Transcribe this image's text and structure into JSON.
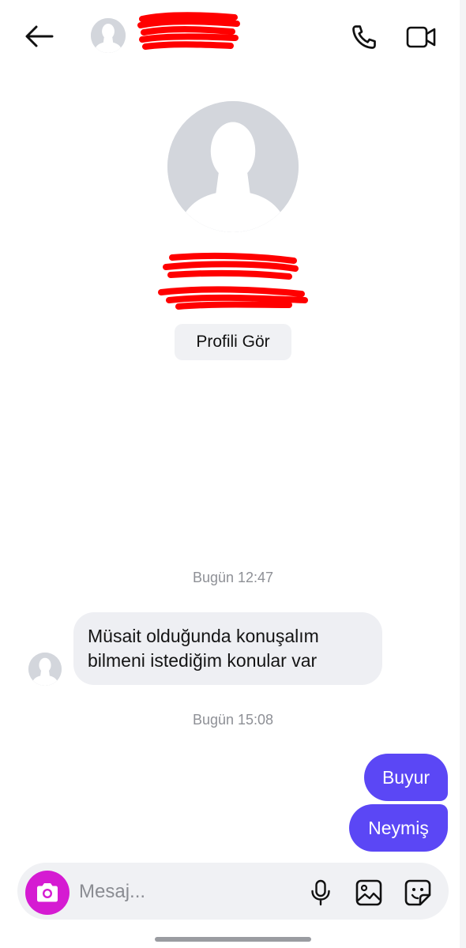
{
  "header": {
    "back_icon": "arrow-left-icon",
    "avatar_icon": "default-avatar-icon",
    "call_icon": "phone-icon",
    "video_icon": "video-camera-icon"
  },
  "profile": {
    "view_profile_label": "Profili Gör"
  },
  "messages": {
    "timestamp_1": "Bugün 12:47",
    "incoming_1_line1": "Müsait olduğunda konuşalım",
    "incoming_1_line2": "bilmeni istediğim konular var",
    "timestamp_2": "Bugün 15:08",
    "outgoing_1": "Buyur",
    "outgoing_2": "Neymiş"
  },
  "composer": {
    "placeholder": "Mesaj...",
    "camera_icon": "camera-icon",
    "mic_icon": "microphone-icon",
    "gallery_icon": "image-icon",
    "sticker_icon": "sticker-icon"
  },
  "colors": {
    "accent": "#5b47f5",
    "camera": "#d51bd2",
    "redaction": "#ff0000"
  }
}
